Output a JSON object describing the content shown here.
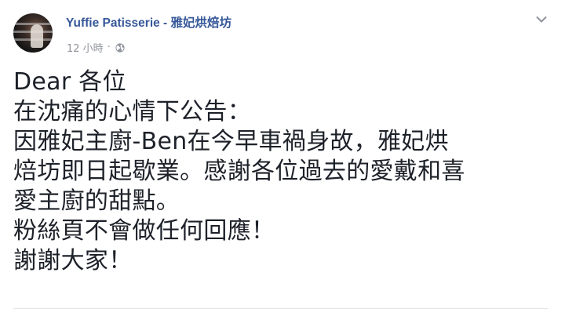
{
  "post": {
    "page_name": "Yuffie Patisserie - 雅妃烘焙坊",
    "timestamp": "12 小時",
    "separator": "·",
    "audience_icon": "globe-icon",
    "options_icon": "chevron-down-icon",
    "body_lines": [
      "Dear 各位",
      "在沈痛的心情下公告：",
      "因雅妃主廚-Ben在今早車禍身故，雅妃烘",
      "焙坊即日起歇業。感謝各位過去的愛戴和喜",
      "愛主廚的甜點。",
      "粉絲頁不會做任何回應！",
      "謝謝大家！"
    ]
  },
  "colors": {
    "link": "#365899",
    "meta": "#90949c",
    "text": "#1d2129",
    "divider": "#e5e5e5"
  }
}
